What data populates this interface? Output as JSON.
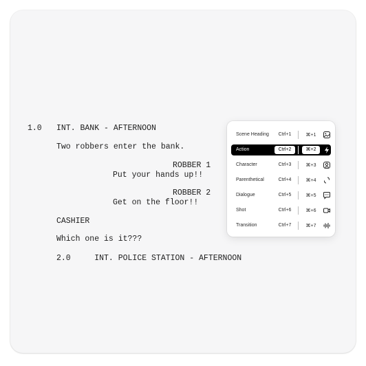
{
  "script": {
    "scene1_number": "1.0",
    "scene1_heading": "INT. BANK - AFTERNOON",
    "action1": "Two robbers enter the bank.",
    "char1": "ROBBER 1",
    "dialogue1": "Put your hands up!!",
    "char2": "ROBBER 2",
    "dialogue2": "Get on the floor!!",
    "char3": "CASHIER",
    "line_cashier": "Which one is it???",
    "scene2": "2.0     INT. POLICE STATION - AFTERNOON"
  },
  "menu": {
    "items": [
      {
        "label": "Scene Heading",
        "ctrl": "Ctrl+1",
        "cmd": "⌘+1",
        "icon": "image-icon",
        "active": false
      },
      {
        "label": "Action",
        "ctrl": "Ctrl+2",
        "cmd": "⌘+2",
        "icon": "lightning-icon",
        "active": true
      },
      {
        "label": "Character",
        "ctrl": "Ctrl+3",
        "cmd": "⌘+3",
        "icon": "person-icon",
        "active": false
      },
      {
        "label": "Parenthetical",
        "ctrl": "Ctrl+4",
        "cmd": "⌘+4",
        "icon": "parenthesis-icon",
        "active": false
      },
      {
        "label": "Dialogue",
        "ctrl": "Ctrl+5",
        "cmd": "⌘+5",
        "icon": "chat-bubble-icon",
        "active": false
      },
      {
        "label": "Shot",
        "ctrl": "Ctrl+6",
        "cmd": "⌘+6",
        "icon": "camera-icon",
        "active": false
      },
      {
        "label": "Transition",
        "ctrl": "Ctrl+7",
        "cmd": "⌘+7",
        "icon": "audio-wave-icon",
        "active": false
      }
    ]
  }
}
